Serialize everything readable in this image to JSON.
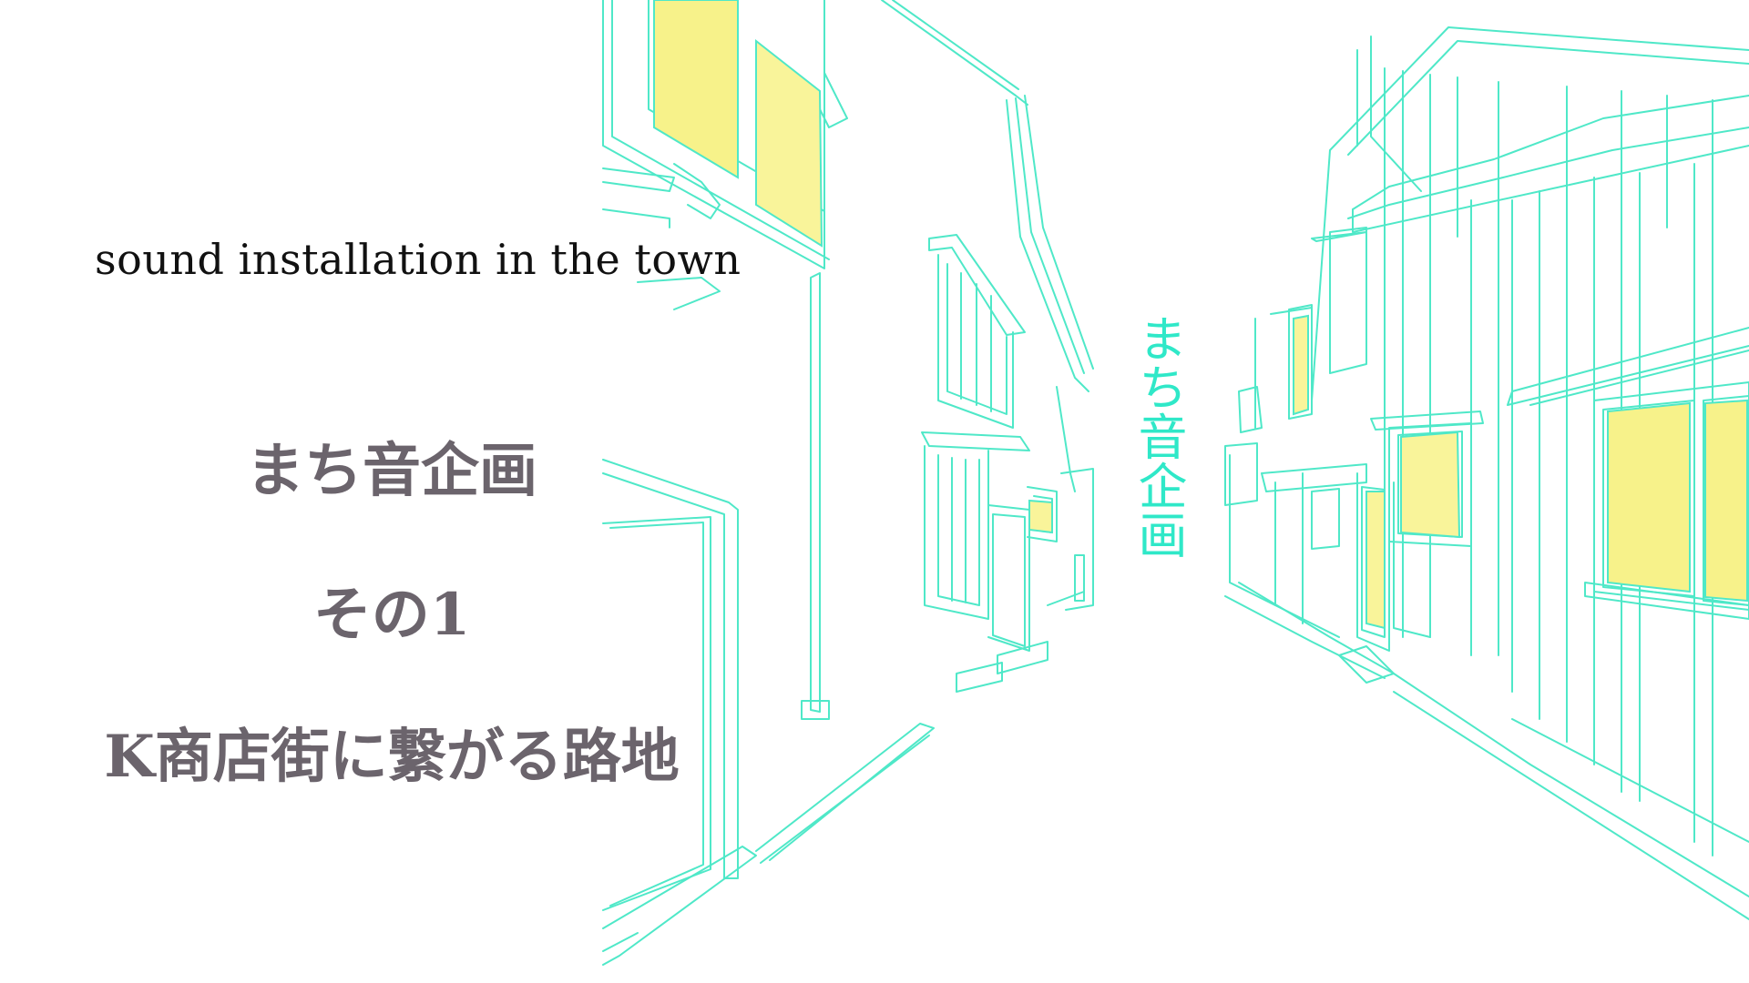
{
  "subtitle": "sound installation in the town",
  "title": {
    "line1": "まち音企画",
    "line2": "その1",
    "line3": "K商店街に繋がる路地"
  },
  "logo_vertical": "まち音企画",
  "colors": {
    "background": "#ffffff",
    "line_art": "#4fe8c8",
    "window_fill": "#f7f28a",
    "title_text": "#6b646c",
    "subtitle_text": "#111111",
    "logo_text": "#2fe8c8"
  }
}
